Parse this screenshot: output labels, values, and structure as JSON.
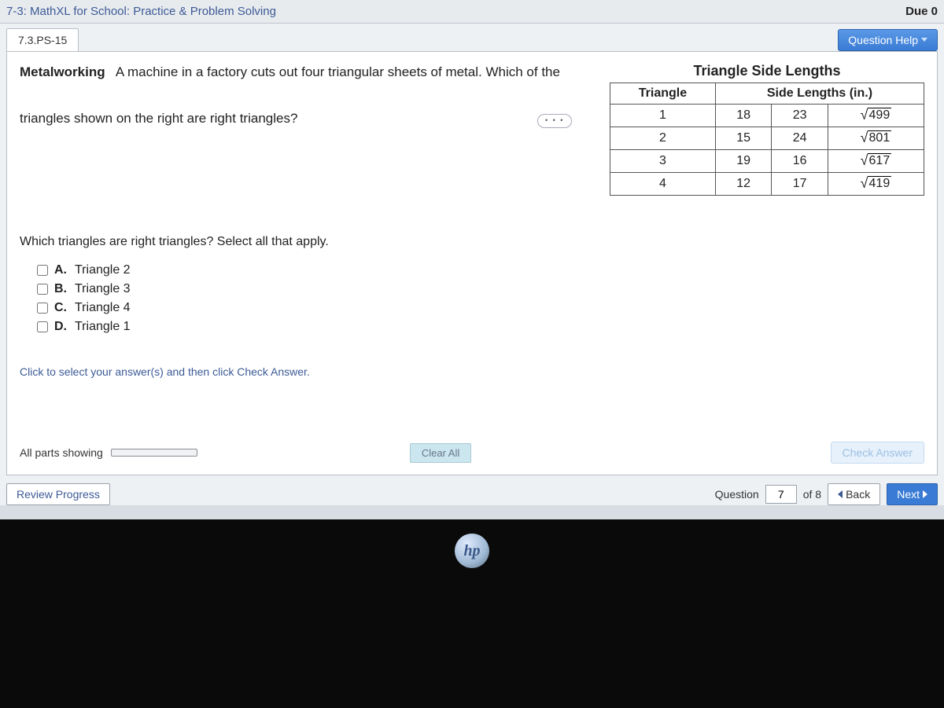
{
  "assignment": {
    "title": "7-3: MathXL for School: Practice & Problem Solving",
    "due_label": "Due 0"
  },
  "question": {
    "id_tab": "7.3.PS-15",
    "help_label": "Question Help",
    "topic": "Metalworking",
    "prompt": "A machine in a factory cuts out four triangular sheets of metal. Which of the triangles shown on the right are right triangles?",
    "subprompt": "Which triangles are right triangles? Select all that apply.",
    "instruction": "Click to select your answer(s) and then click Check Answer."
  },
  "table": {
    "title": "Triangle Side Lengths",
    "col_triangle": "Triangle",
    "col_sides": "Side Lengths (in.)",
    "rows": [
      {
        "n": "1",
        "a": "18",
        "b": "23",
        "c_radicand": "499"
      },
      {
        "n": "2",
        "a": "15",
        "b": "24",
        "c_radicand": "801"
      },
      {
        "n": "3",
        "a": "19",
        "b": "16",
        "c_radicand": "617"
      },
      {
        "n": "4",
        "a": "12",
        "b": "17",
        "c_radicand": "419"
      }
    ]
  },
  "choices": [
    {
      "key": "A.",
      "label": "Triangle 2"
    },
    {
      "key": "B.",
      "label": "Triangle 3"
    },
    {
      "key": "C.",
      "label": "Triangle 4"
    },
    {
      "key": "D.",
      "label": "Triangle 1"
    }
  ],
  "footer": {
    "all_parts": "All parts showing",
    "clear_label": "Clear All",
    "check_label": "Check Answer",
    "review_label": "Review Progress",
    "question_label": "Question",
    "current": "7",
    "of_label": "of 8",
    "back_label": "Back",
    "next_label": "Next"
  },
  "logo": {
    "text": "hp"
  }
}
